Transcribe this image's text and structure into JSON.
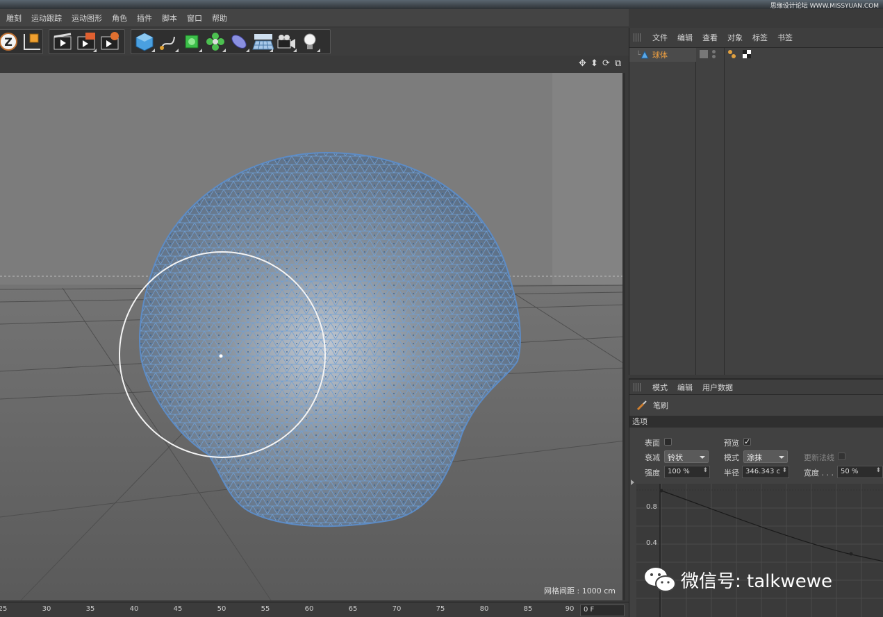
{
  "watermark_top": "思缘设计论坛 WWW.MISSYUAN.COM",
  "menu": [
    "雕刻",
    "运动跟踪",
    "运动图形",
    "角色",
    "插件",
    "脚本",
    "窗口",
    "帮助"
  ],
  "viewport": {
    "grid_spacing_label": "网格间距 : 1000 cm"
  },
  "timeline": {
    "ticks": [
      "25",
      "30",
      "35",
      "40",
      "45",
      "50",
      "55",
      "60",
      "65",
      "70",
      "75",
      "80",
      "85",
      "90"
    ],
    "current_frame": "0 F"
  },
  "object_manager": {
    "tabs": [
      "文件",
      "编辑",
      "查看",
      "对象",
      "标签",
      "书签"
    ],
    "objects": [
      {
        "name": "球体"
      }
    ]
  },
  "attribute_manager": {
    "tabs": [
      "模式",
      "编辑",
      "用户数据"
    ],
    "tool_name": "笔刷",
    "section_title": "选项",
    "surface_label": "表面",
    "preview_label": "预览",
    "falloff_label": "衰减",
    "falloff_value": "铃状",
    "mode_label": "模式",
    "mode_value": "涂抹",
    "update_normals_label": "更新法线",
    "strength_label": "强度",
    "strength_value": "100 %",
    "radius_label": "半径",
    "radius_value": "346.343 c",
    "width_label": "宽度 . . .",
    "width_value": "50 %",
    "graph_labels": [
      "0.8",
      "0.4"
    ]
  },
  "wechat_watermark": "微信号: talkwewe",
  "colors": {
    "mesh": "#6e9fd6",
    "object_name": "#f0a040"
  }
}
